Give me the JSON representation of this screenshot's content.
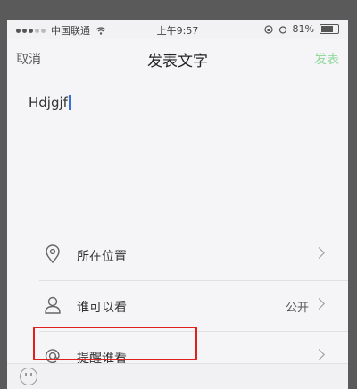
{
  "status_bar": {
    "carrier": "中国联通",
    "time": "上午9:57",
    "battery": "81%"
  },
  "nav": {
    "cancel_label": "取消",
    "title": "发表文字",
    "publish_label": "发表"
  },
  "compose": {
    "text": "Hdjgjf"
  },
  "options": {
    "location_label": "所在位置",
    "visibility_label": "谁可以看",
    "visibility_value": "公开",
    "mention_label": "提醒谁看"
  },
  "colors": {
    "publish_disabled": "#8fd99a",
    "highlight": "#e0201c"
  }
}
